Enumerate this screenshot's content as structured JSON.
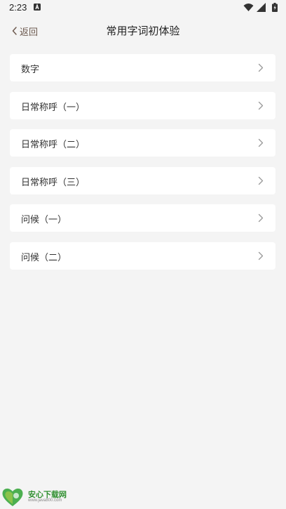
{
  "status_bar": {
    "time": "2:23"
  },
  "nav": {
    "back_label": "返回",
    "title": "常用字词初体验"
  },
  "list": {
    "items": [
      {
        "label": "数字"
      },
      {
        "label": "日常称呼（一）"
      },
      {
        "label": "日常称呼（二）"
      },
      {
        "label": "日常称呼（三）"
      },
      {
        "label": "问候（一）"
      },
      {
        "label": "问候（二）"
      }
    ]
  },
  "watermark": {
    "name": "安心下载网",
    "url": "www.java800.com"
  },
  "colors": {
    "background": "#f4f4f4",
    "card": "#ffffff",
    "back_text": "#6d5a4f",
    "watermark_green": "#2f8f2f"
  }
}
